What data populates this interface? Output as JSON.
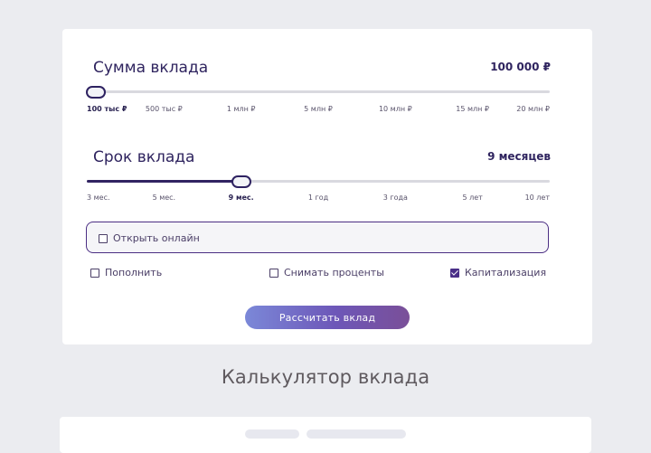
{
  "deposit_amount": {
    "title": "Сумма вклада",
    "value": "100 000 ₽",
    "ticks": [
      "100 тыс ₽",
      "500 тыс ₽",
      "1 млн ₽",
      "5 млн ₽",
      "10 млн ₽",
      "15 млн ₽",
      "20 млн ₽"
    ],
    "selected_index": 0
  },
  "deposit_term": {
    "title": "Срок вклада",
    "value": "9 месяцев",
    "ticks": [
      "3 мес.",
      "5 мес.",
      "9 мес.",
      "1 год",
      "3 года",
      "5 лет",
      "10 лет"
    ],
    "selected_index": 2
  },
  "options": {
    "online": {
      "label": "Открыть онлайн",
      "checked": false
    },
    "replenish": {
      "label": "Пополнить",
      "checked": false
    },
    "withdraw_interest": {
      "label": "Снимать проценты",
      "checked": false
    },
    "capitalization": {
      "label": "Капитализация",
      "checked": true
    }
  },
  "actions": {
    "calculate_label": "Рассчитать вклад"
  },
  "section": {
    "title": "Калькулятор вклада"
  }
}
